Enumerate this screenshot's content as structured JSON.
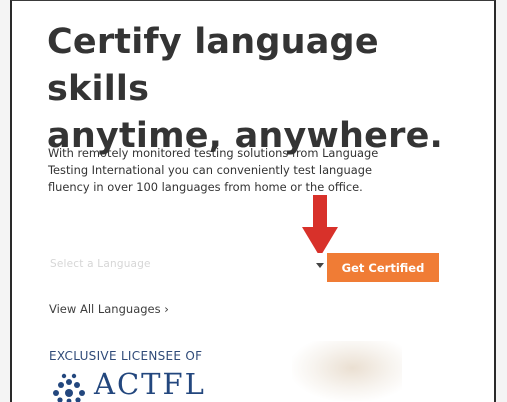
{
  "hero": {
    "headline_line1": "Certify language skills",
    "headline_line2": "anytime, anywhere.",
    "description": "With remotely monitored testing solutions from Language Testing International you can conveniently test language fluency in over 100 languages from home or the office."
  },
  "language_select": {
    "placeholder": "Select a Language"
  },
  "cta": {
    "label": "Get Certified"
  },
  "links": {
    "view_all": "View All Languages ›"
  },
  "licensee": {
    "label": "EXCLUSIVE LICENSEE OF",
    "logo_text": "ACTFL"
  },
  "colors": {
    "accent_button": "#f07c35",
    "annotation_arrow": "#d8312a",
    "actfl_blue": "#23477e"
  },
  "icons": {
    "dropdown": "chevron-down-icon",
    "annotation": "red-arrow-icon",
    "logo": "actfl-mark-icon"
  }
}
